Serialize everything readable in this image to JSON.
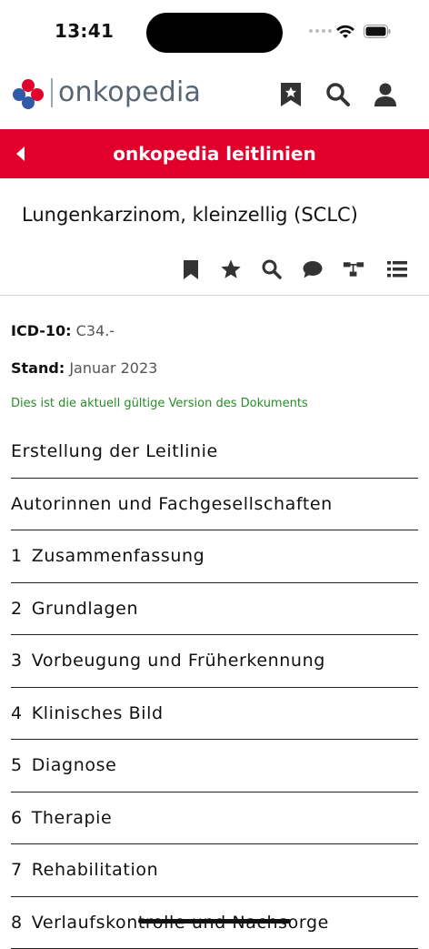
{
  "status": {
    "time": "13:41"
  },
  "header": {
    "logo_text": "onkopedia"
  },
  "nav": {
    "title": "onkopedia leitlinien"
  },
  "document": {
    "title": "Lungenkarzinom, kleinzellig (SCLC)",
    "icd_label": "ICD-10:",
    "icd_value": "C34.-",
    "stand_label": "Stand:",
    "stand_value": "Januar 2023",
    "valid_note": "Dies ist die aktuell gültige Version des Dokuments"
  },
  "sections": [
    {
      "num": "",
      "label": "Erstellung der Leitlinie"
    },
    {
      "num": "",
      "label": "Autorinnen und Fachgesellschaften"
    },
    {
      "num": "1",
      "label": "Zusammenfassung"
    },
    {
      "num": "2",
      "label": "Grundlagen"
    },
    {
      "num": "3",
      "label": "Vorbeugung und Früherkennung"
    },
    {
      "num": "4",
      "label": "Klinisches Bild"
    },
    {
      "num": "5",
      "label": "Diagnose"
    },
    {
      "num": "6",
      "label": "Therapie"
    },
    {
      "num": "7",
      "label": "Rehabilitation"
    },
    {
      "num": "8",
      "label": "Verlaufskontrolle und Nachsorge"
    }
  ],
  "colors": {
    "brand_red": "#e1002b",
    "logo_grey": "#586674",
    "valid_green": "#2a8a2a"
  },
  "icons": {
    "header": [
      "bookmark-star-icon",
      "search-icon",
      "user-icon"
    ],
    "toolbar": [
      "bookmark-icon",
      "star-icon",
      "search-icon",
      "comment-icon",
      "sitemap-icon",
      "list-icon"
    ]
  }
}
